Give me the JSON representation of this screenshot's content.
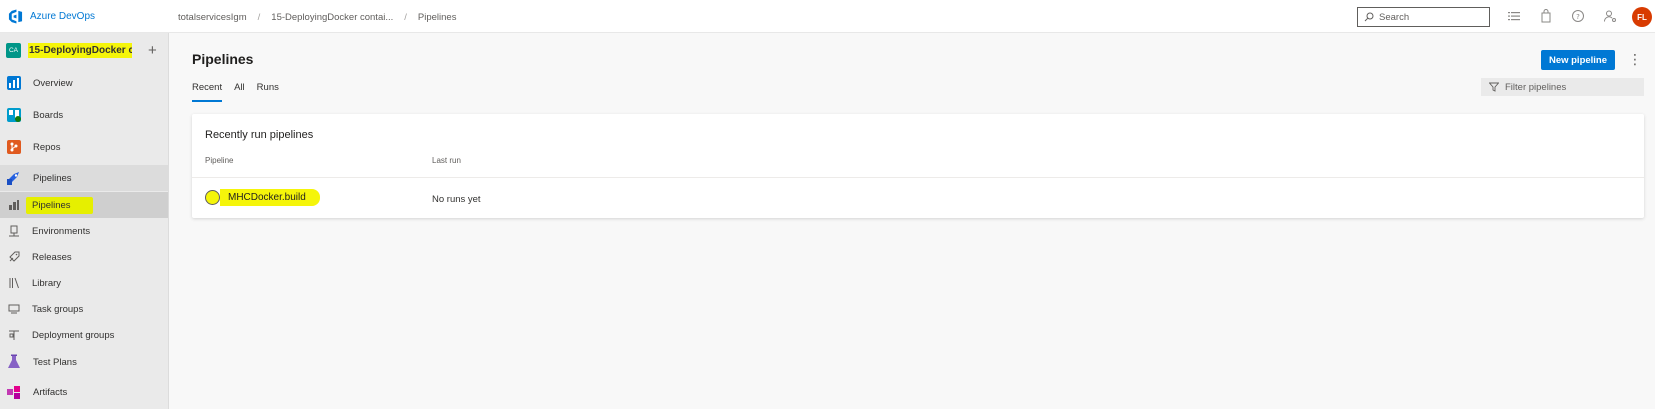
{
  "header": {
    "brand": "Azure DevOps",
    "breadcrumb": [
      "totalservicesIgm",
      "15-DeployingDocker contai...",
      "Pipelines"
    ],
    "search_placeholder": "Search",
    "avatar_initials": "FL"
  },
  "sidebar": {
    "project_badge": "CA",
    "project_name": "15-DeployingDocker c...",
    "items": [
      {
        "label": "Overview",
        "icon": "overview-icon"
      },
      {
        "label": "Boards",
        "icon": "boards-icon"
      },
      {
        "label": "Repos",
        "icon": "repos-icon"
      },
      {
        "label": "Pipelines",
        "icon": "pipelines-icon"
      },
      {
        "label": "Pipelines",
        "icon": "pipelines-sub-icon"
      },
      {
        "label": "Environments",
        "icon": "environments-icon"
      },
      {
        "label": "Releases",
        "icon": "releases-icon"
      },
      {
        "label": "Library",
        "icon": "library-icon"
      },
      {
        "label": "Task groups",
        "icon": "task-groups-icon"
      },
      {
        "label": "Deployment groups",
        "icon": "deployment-groups-icon"
      },
      {
        "label": "Test Plans",
        "icon": "test-plans-icon"
      },
      {
        "label": "Artifacts",
        "icon": "artifacts-icon"
      }
    ]
  },
  "main": {
    "title": "Pipelines",
    "new_button": "New pipeline",
    "tabs": [
      "Recent",
      "All",
      "Runs"
    ],
    "filter_placeholder": "Filter pipelines",
    "card": {
      "title": "Recently run pipelines",
      "columns": [
        "Pipeline",
        "Last run"
      ],
      "rows": [
        {
          "name": "MHCDocker.build",
          "last_run": "No runs yet"
        }
      ]
    }
  },
  "colors": {
    "accent": "#0078d4",
    "highlight": "#f5f50a",
    "avatar": "#d83b01"
  }
}
